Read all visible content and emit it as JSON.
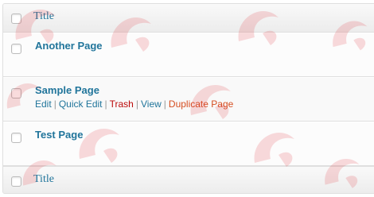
{
  "table": {
    "header_label": "Title",
    "footer_label": "Title",
    "rows": [
      {
        "title": "Another Page"
      },
      {
        "title": "Sample Page",
        "actions": {
          "edit": "Edit",
          "quick_edit": "Quick Edit",
          "trash": "Trash",
          "view": "View",
          "duplicate": "Duplicate Page",
          "separator": "|"
        }
      },
      {
        "title": "Test Page"
      }
    ]
  },
  "colors": {
    "link": "#21759b",
    "trash": "#bc0b0b",
    "duplicate": "#d54e21",
    "border": "#dfdfdf"
  }
}
